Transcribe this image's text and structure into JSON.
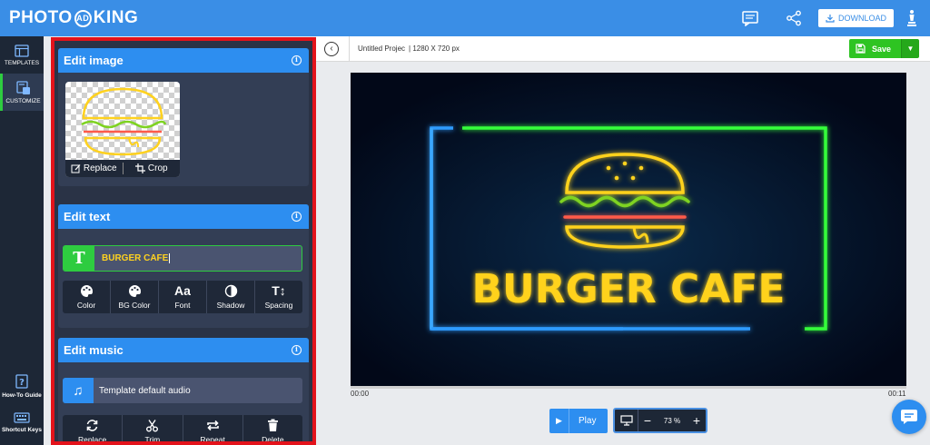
{
  "header": {
    "logo_left": "PHOTO",
    "logo_mark": "AD",
    "logo_right": "KING",
    "download_label": "DOWNLOAD"
  },
  "nav": {
    "templates_label": "TEMPLATES",
    "customize_label": "CUSTOMIZE",
    "howto_label": "How-To Guide",
    "shortcuts_label": "Shortcut Keys"
  },
  "edit_image": {
    "title": "Edit image",
    "replace_label": "Replace",
    "crop_label": "Crop"
  },
  "edit_text": {
    "title": "Edit text",
    "value": "BURGER CAFE",
    "icon_letter": "T",
    "tools": [
      {
        "label": "Color"
      },
      {
        "label": "BG Color"
      },
      {
        "label": "Font",
        "glyph": "Aa"
      },
      {
        "label": "Shadow"
      },
      {
        "label": "Spacing",
        "glyph": "T↕"
      }
    ]
  },
  "edit_music": {
    "title": "Edit music",
    "audio_label": "Template default audio",
    "tools": [
      {
        "label": "Replace"
      },
      {
        "label": "Trim"
      },
      {
        "label": "Repeat"
      },
      {
        "label": "Delete"
      }
    ]
  },
  "workspace": {
    "project_name": "Untitled Projec",
    "project_size": "| 1280 X 720 px",
    "save_label": "Save",
    "time_start": "00:00",
    "time_end": "00:11",
    "play_label": "Play",
    "zoom_value": "73 %"
  },
  "canvas": {
    "headline": "BURGER CAFE",
    "colors": {
      "background": "#04102a",
      "neon_blue": "#2d9bff",
      "neon_green": "#35ff3a",
      "neon_yellow": "#ffd21f",
      "neon_red": "#ff5a4a"
    }
  },
  "colors": {
    "accent": "#2d8ef0",
    "save_green": "#2ec422",
    "panel_bg": "#2a3346",
    "highlight_border": "#e3131b"
  }
}
